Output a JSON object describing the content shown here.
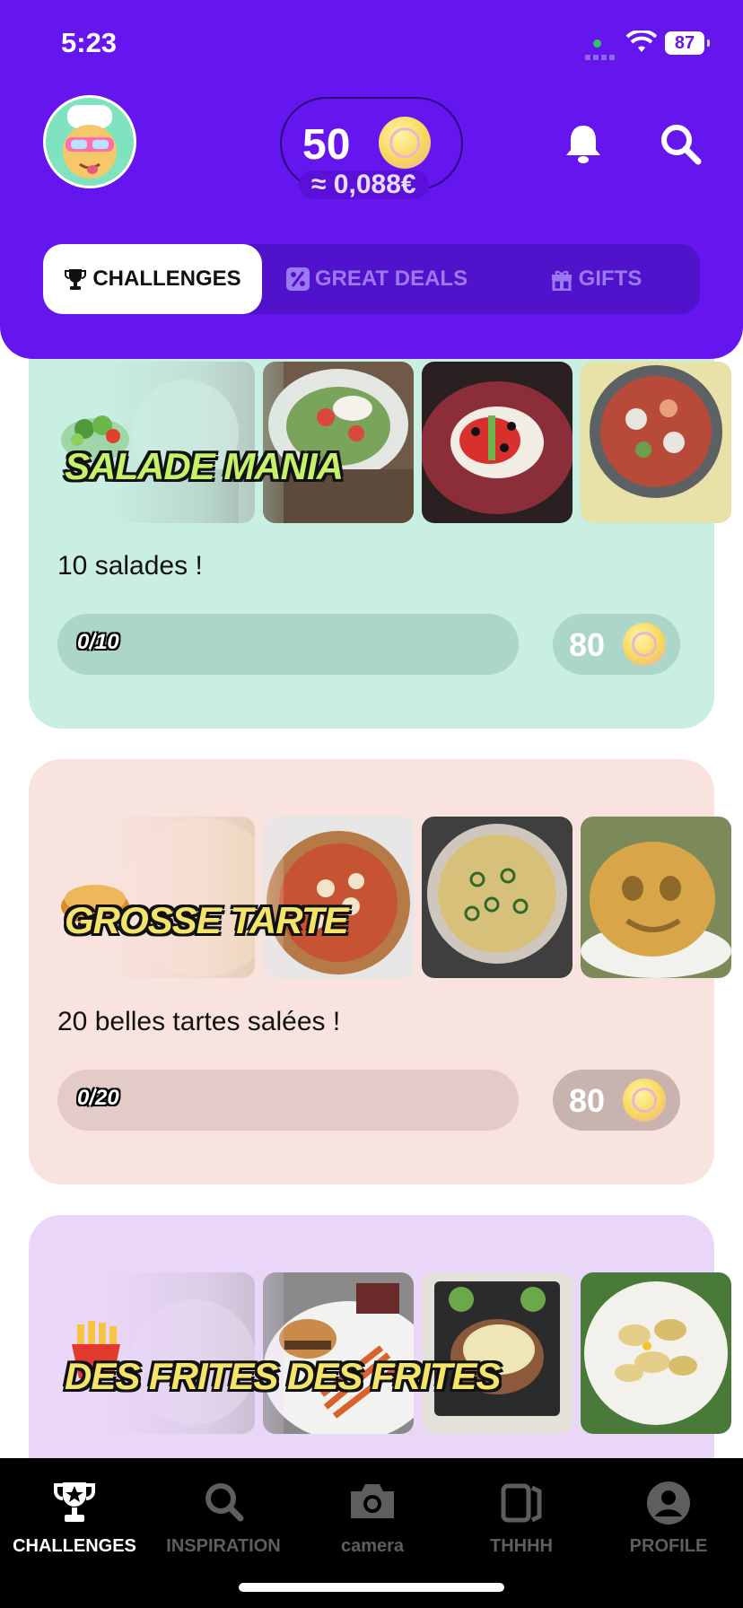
{
  "status_bar": {
    "time": "5:23",
    "battery": "87"
  },
  "header": {
    "coins": "50",
    "coins_eur": "≈ 0,088€"
  },
  "tabs": [
    {
      "label": "CHALLENGES",
      "active": true
    },
    {
      "label": "GREAT DEALS",
      "active": false
    },
    {
      "label": "GIFTS",
      "active": false
    }
  ],
  "challenges": [
    {
      "title": "SALADE MANIA",
      "description": "10 salades !",
      "progress": "0/10",
      "progress_fraction": 0,
      "reward": "80",
      "bg_color": "#c9eee2",
      "track_color": "#acd6c9"
    },
    {
      "title": "GROSSE TARTE",
      "description": "20 belles tartes salées !",
      "progress": "0/20",
      "progress_fraction": 0,
      "reward": "80",
      "bg_color": "#f9e3df",
      "track_color": "#e3ccc7"
    },
    {
      "title": "DES FRITES DES FRITES",
      "bg_color": "#ead7f7"
    }
  ],
  "bottom_nav": [
    {
      "label": "CHALLENGES",
      "icon": "trophy-icon",
      "active": true
    },
    {
      "label": "INSPIRATION",
      "icon": "search-icon",
      "active": false
    },
    {
      "label": "camera",
      "icon": "camera-icon",
      "active": false
    },
    {
      "label": "THHHH",
      "icon": "cards-icon",
      "active": false
    },
    {
      "label": "PROFILE",
      "icon": "profile-icon",
      "active": false
    }
  ]
}
